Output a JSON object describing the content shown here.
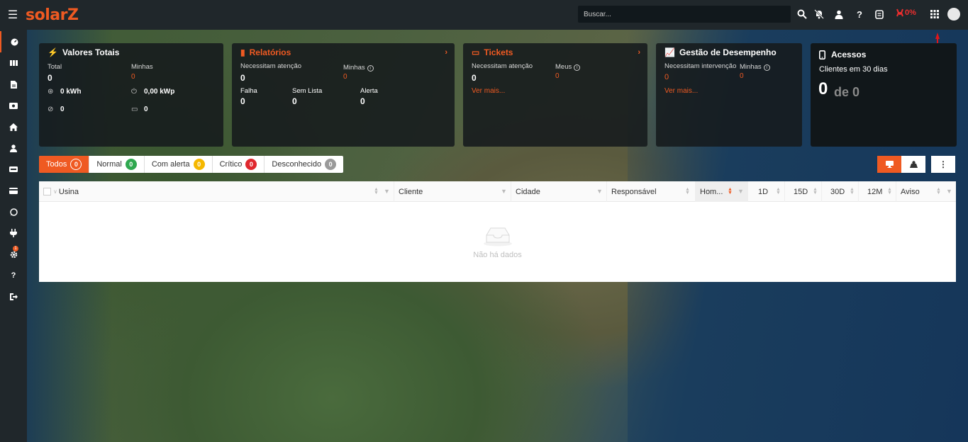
{
  "app": {
    "logo": "solarZ"
  },
  "topbar": {
    "search_placeholder": "Buscar...",
    "percent": "0%",
    "icons": [
      "search-icon",
      "bell-off-icon",
      "user-badge-icon",
      "help-icon",
      "report-icon",
      "alert-percent-icon",
      "apps-grid-icon",
      "avatar"
    ]
  },
  "sidebar": {
    "items": [
      "dashboard-icon",
      "plants-icon",
      "document-icon",
      "ticket-icon",
      "home-icon",
      "user-icon",
      "card-icon",
      "billing-icon",
      "whatsapp-icon",
      "plug-icon",
      "settings-icon",
      "help-icon",
      "logout-icon"
    ],
    "settings_badge": "1"
  },
  "cards": {
    "totais": {
      "title": "Valores Totais",
      "total_label": "Total",
      "total_value": "0",
      "minhas_label": "Minhas",
      "minhas_value": "0",
      "kwh": "0 kWh",
      "kwp": "0,00 kWp",
      "count_a": "0",
      "count_b": "0"
    },
    "relatorios": {
      "title": "Relatórios",
      "atencao_label": "Necessitam atenção",
      "atencao_value": "0",
      "minhas_label": "Minhas",
      "minhas_value": "0",
      "falha_label": "Falha",
      "falha_value": "0",
      "semlista_label": "Sem Lista",
      "semlista_value": "0",
      "alerta_label": "Alerta",
      "alerta_value": "0"
    },
    "tickets": {
      "title": "Tickets",
      "atencao_label": "Necessitam atenção",
      "atencao_value": "0",
      "meus_label": "Meus",
      "meus_value": "0",
      "link": "Ver mais..."
    },
    "desempenho": {
      "title": "Gestão de Desempenho",
      "intervencao_label": "Necessitam intervenção",
      "intervencao_value": "0",
      "minhas_label": "Minhas",
      "minhas_value": "0",
      "link": "Ver mais..."
    },
    "acessos": {
      "title": "Acessos",
      "subtitle": "Clientes em 30 dias",
      "value": "0",
      "of_text": "de 0"
    }
  },
  "filters": [
    {
      "label": "Todos",
      "count": "0",
      "color": "#ef5a22"
    },
    {
      "label": "Normal",
      "count": "0",
      "color": "#2fa84f"
    },
    {
      "label": "Com alerta",
      "count": "0",
      "color": "#f5b800"
    },
    {
      "label": "Crítico",
      "count": "0",
      "color": "#e0282e"
    },
    {
      "label": "Desconhecido",
      "count": "0",
      "color": "#9a9a9a"
    }
  ],
  "table": {
    "columns": [
      "Usina",
      "Cliente",
      "Cidade",
      "Responsável",
      "Hom...",
      "1D",
      "15D",
      "30D",
      "12M",
      "Aviso"
    ],
    "empty_text": "Não há dados"
  },
  "colors": {
    "accent": "#ef5a22",
    "topbar": "#20272b"
  }
}
